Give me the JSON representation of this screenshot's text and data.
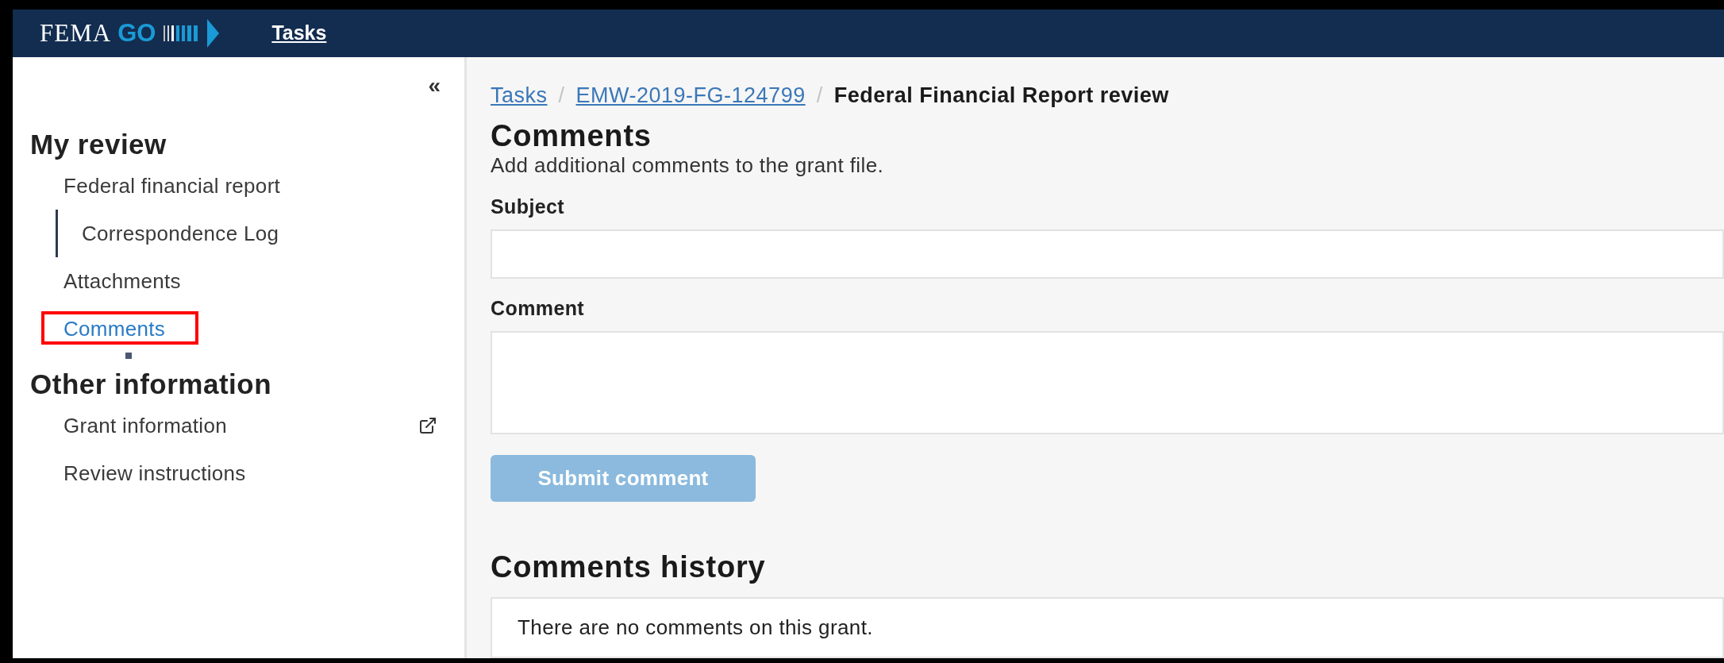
{
  "header": {
    "logo": {
      "word": "FEMA",
      "accent": "GO"
    },
    "nav": [
      {
        "label": "Tasks"
      }
    ]
  },
  "sidebar": {
    "collapse": "«",
    "sections": [
      {
        "title": "My review",
        "items": [
          {
            "label": "Federal financial report",
            "external": false,
            "selected": false,
            "children": [
              {
                "label": "Correspondence Log",
                "external": false,
                "selected": false
              }
            ]
          },
          {
            "label": "Attachments",
            "external": false,
            "selected": false
          },
          {
            "label": "Comments",
            "external": false,
            "selected": true
          }
        ]
      },
      {
        "title": "Other information",
        "items": [
          {
            "label": "Grant information",
            "external": true,
            "selected": false
          },
          {
            "label": "Review instructions",
            "external": false,
            "selected": false
          }
        ]
      }
    ]
  },
  "breadcrumbs": {
    "separator": "/",
    "items": [
      {
        "label": "Tasks",
        "kind": "link"
      },
      {
        "label": "EMW-2019-FG-124799",
        "kind": "link"
      },
      {
        "label": "Federal Financial Report review",
        "kind": "current"
      }
    ]
  },
  "page": {
    "title": "Comments",
    "description": "Add additional comments to the grant file."
  },
  "form": {
    "fields": [
      {
        "label": "Subject",
        "kind": "input"
      },
      {
        "label": "Comment",
        "kind": "textarea"
      }
    ],
    "submit": {
      "label": "Submit comment",
      "disabled": true
    }
  },
  "history": {
    "title": "Comments history",
    "empty_message": "There are no comments on this grant."
  }
}
